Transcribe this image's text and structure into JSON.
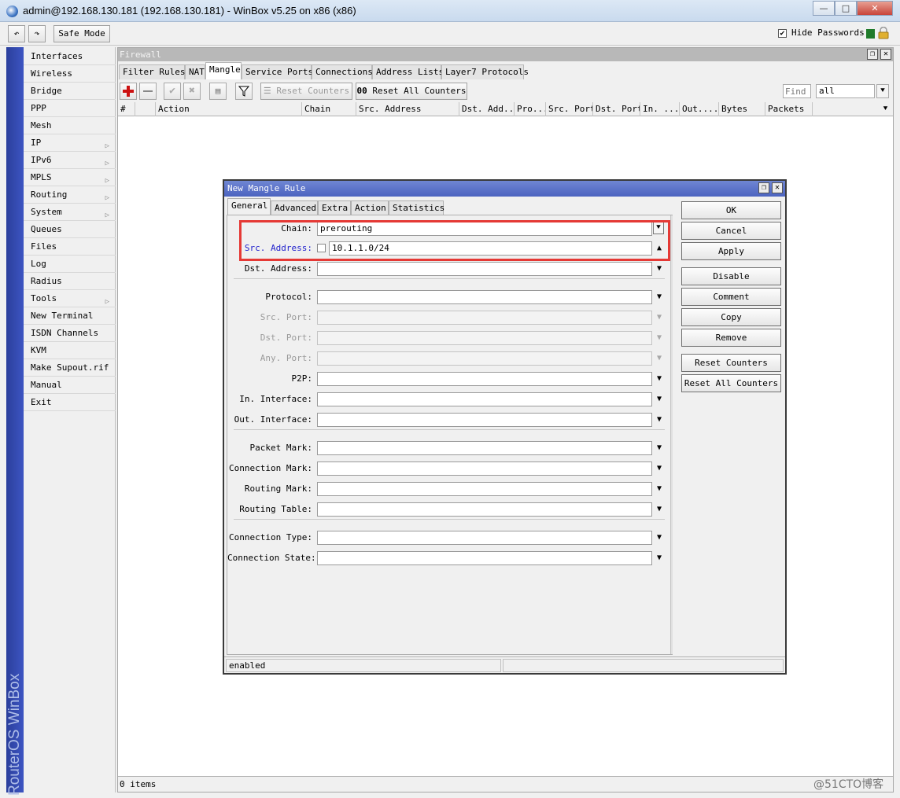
{
  "window": {
    "title": "admin@192.168.130.181 (192.168.130.181) - WinBox v5.25 on x86 (x86)",
    "min_glyph": "—",
    "max_glyph": "□",
    "close_glyph": "✕"
  },
  "toolbar": {
    "undo_glyph": "↶",
    "redo_glyph": "↷",
    "safe_mode_label": "Safe Mode",
    "hide_passwords_label": "Hide Passwords",
    "hide_passwords_checked": true
  },
  "side_strip": {
    "text": "RouterOS WinBox"
  },
  "menu": {
    "items": [
      {
        "label": "Interfaces",
        "submenu": false
      },
      {
        "label": "Wireless",
        "submenu": false
      },
      {
        "label": "Bridge",
        "submenu": false
      },
      {
        "label": "PPP",
        "submenu": false
      },
      {
        "label": "Mesh",
        "submenu": false
      },
      {
        "label": "IP",
        "submenu": true
      },
      {
        "label": "IPv6",
        "submenu": true
      },
      {
        "label": "MPLS",
        "submenu": true
      },
      {
        "label": "Routing",
        "submenu": true
      },
      {
        "label": "System",
        "submenu": true
      },
      {
        "label": "Queues",
        "submenu": false
      },
      {
        "label": "Files",
        "submenu": false
      },
      {
        "label": "Log",
        "submenu": false
      },
      {
        "label": "Radius",
        "submenu": false
      },
      {
        "label": "Tools",
        "submenu": true
      },
      {
        "label": "New Terminal",
        "submenu": false
      },
      {
        "label": "ISDN Channels",
        "submenu": false
      },
      {
        "label": "KVM",
        "submenu": false
      },
      {
        "label": "Make Supout.rif",
        "submenu": false
      },
      {
        "label": "Manual",
        "submenu": false
      },
      {
        "label": "Exit",
        "submenu": false
      }
    ],
    "submenu_glyph": "▷"
  },
  "firewall": {
    "title": "Firewall",
    "tabs": [
      {
        "label": "Filter Rules",
        "active": false
      },
      {
        "label": "NAT",
        "active": false
      },
      {
        "label": "Mangle",
        "active": true
      },
      {
        "label": "Service Ports",
        "active": false
      },
      {
        "label": "Connections",
        "active": false
      },
      {
        "label": "Address Lists",
        "active": false
      },
      {
        "label": "Layer7 Protocols",
        "active": false
      }
    ],
    "reset_counters_label": "Reset Counters",
    "reset_all_counters_label": "Reset All Counters",
    "reset_all_prefix": "00",
    "find_placeholder": "Find",
    "filter_value": "all",
    "columns": [
      "#",
      "",
      "Action",
      "Chain",
      "Src. Address",
      "Dst. Add...",
      "Pro...",
      "Src. Port",
      "Dst. Port",
      "In. ...",
      "Out....",
      "Bytes",
      "Packets"
    ],
    "status": "0 items"
  },
  "dialog": {
    "title": "New Mangle Rule",
    "tabs": [
      {
        "label": "General",
        "active": true
      },
      {
        "label": "Advanced",
        "active": false
      },
      {
        "label": "Extra",
        "active": false
      },
      {
        "label": "Action",
        "active": false
      },
      {
        "label": "Statistics",
        "active": false
      }
    ],
    "fields": {
      "chain": {
        "label": "Chain:",
        "value": "prerouting"
      },
      "src_address": {
        "label": "Src. Address:",
        "value": "10.1.1.0/24"
      },
      "dst_address": {
        "label": "Dst. Address:",
        "value": ""
      },
      "protocol": {
        "label": "Protocol:",
        "value": ""
      },
      "src_port": {
        "label": "Src. Port:",
        "value": ""
      },
      "dst_port": {
        "label": "Dst. Port:",
        "value": ""
      },
      "any_port": {
        "label": "Any. Port:",
        "value": ""
      },
      "p2p": {
        "label": "P2P:",
        "value": ""
      },
      "in_interface": {
        "label": "In. Interface:",
        "value": ""
      },
      "out_interface": {
        "label": "Out. Interface:",
        "value": ""
      },
      "packet_mark": {
        "label": "Packet Mark:",
        "value": ""
      },
      "connection_mark": {
        "label": "Connection Mark:",
        "value": ""
      },
      "routing_mark": {
        "label": "Routing Mark:",
        "value": ""
      },
      "routing_table": {
        "label": "Routing Table:",
        "value": ""
      },
      "connection_type": {
        "label": "Connection Type:",
        "value": ""
      },
      "connection_state": {
        "label": "Connection State:",
        "value": ""
      }
    },
    "buttons": {
      "ok": "OK",
      "cancel": "Cancel",
      "apply": "Apply",
      "disable": "Disable",
      "comment": "Comment",
      "copy": "Copy",
      "remove": "Remove",
      "reset_counters": "Reset Counters",
      "reset_all_counters": "Reset All Counters"
    },
    "status": "enabled"
  },
  "watermark": "@51CTO博客",
  "colors": {
    "side_strip": "#3a50b8",
    "dialog_title": "#5a70c8",
    "highlight": "#e53935",
    "label_highlight": "#2222cc"
  }
}
